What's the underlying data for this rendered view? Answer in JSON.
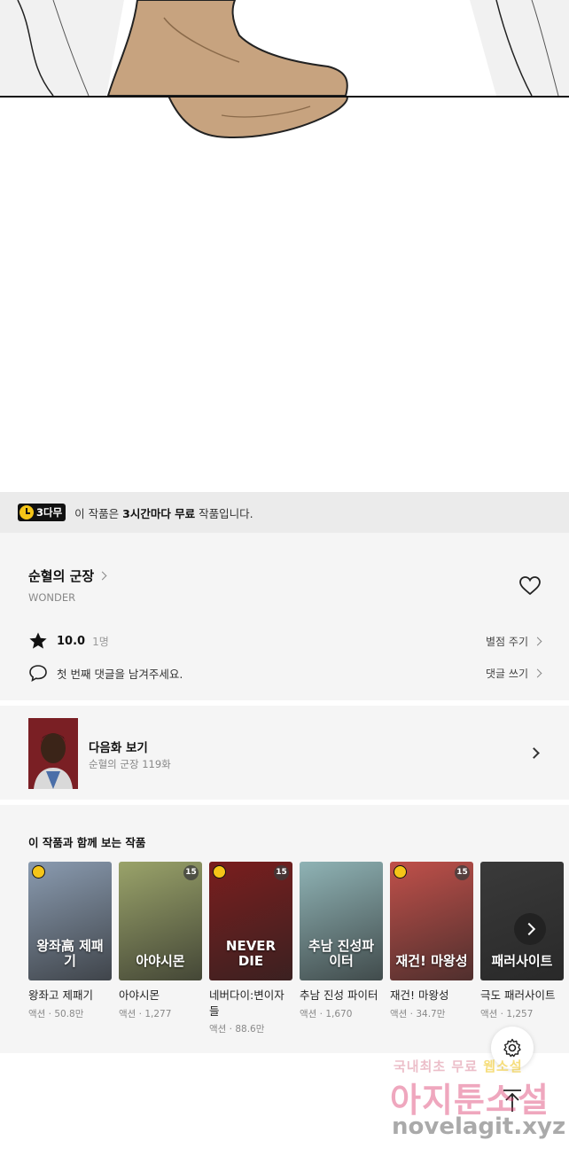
{
  "banner": {
    "badge_label": "3다무",
    "text_prefix": "이 작품은 ",
    "text_bold": "3시간마다 무료",
    "text_suffix": " 작품입니다."
  },
  "work": {
    "title": "순혈의 군장",
    "author": "WONDER",
    "rating_score": "10.0",
    "rating_count": "1명",
    "rate_link": "별점 주기",
    "comment_placeholder": "첫 번째 댓글을 남겨주세요.",
    "comment_link": "댓글 쓰기"
  },
  "next_episode": {
    "label": "다음화 보기",
    "sub": "순혈의 군장 119화"
  },
  "recommendations": {
    "title": "이 작품과 함께 보는 작품",
    "items": [
      {
        "name": "왕좌고 제패기",
        "meta": "액션 · 50.8만",
        "cover_text": "왕좌高 제패기",
        "color": "#8a9bb0",
        "badge": "free"
      },
      {
        "name": "아야시몬",
        "meta": "액션 · 1,277",
        "cover_text": "아야시몬",
        "color": "#9aa36a",
        "badge": "15"
      },
      {
        "name": "네버다이:변이자들",
        "meta": "액션 · 88.6만",
        "cover_text": "NEVER DIE",
        "color": "#7a1e1e",
        "badge": "free15"
      },
      {
        "name": "추남 진성 파이터",
        "meta": "액션 · 1,670",
        "cover_text": "추남 진성파이터",
        "color": "#8fb3b5",
        "badge": ""
      },
      {
        "name": "재건! 마왕성",
        "meta": "액션 · 34.7만",
        "cover_text": "재건! 마왕성",
        "color": "#c0504a",
        "badge": "free15"
      },
      {
        "name": "극도 패러사이트",
        "meta": "액션 · 1,257",
        "cover_text": "패러사이트",
        "color": "#3a3a3a",
        "badge": ""
      }
    ]
  },
  "watermark": {
    "line1_a": "국내최초 무료 ",
    "line1_b": "웹소설",
    "line2": "아지툰소설",
    "line3": "novelagit.xyz"
  },
  "icons": [
    "clock-icon",
    "chevron-right-icon",
    "heart-icon",
    "star-icon",
    "comment-icon",
    "gear-icon",
    "arrow-up-icon"
  ]
}
